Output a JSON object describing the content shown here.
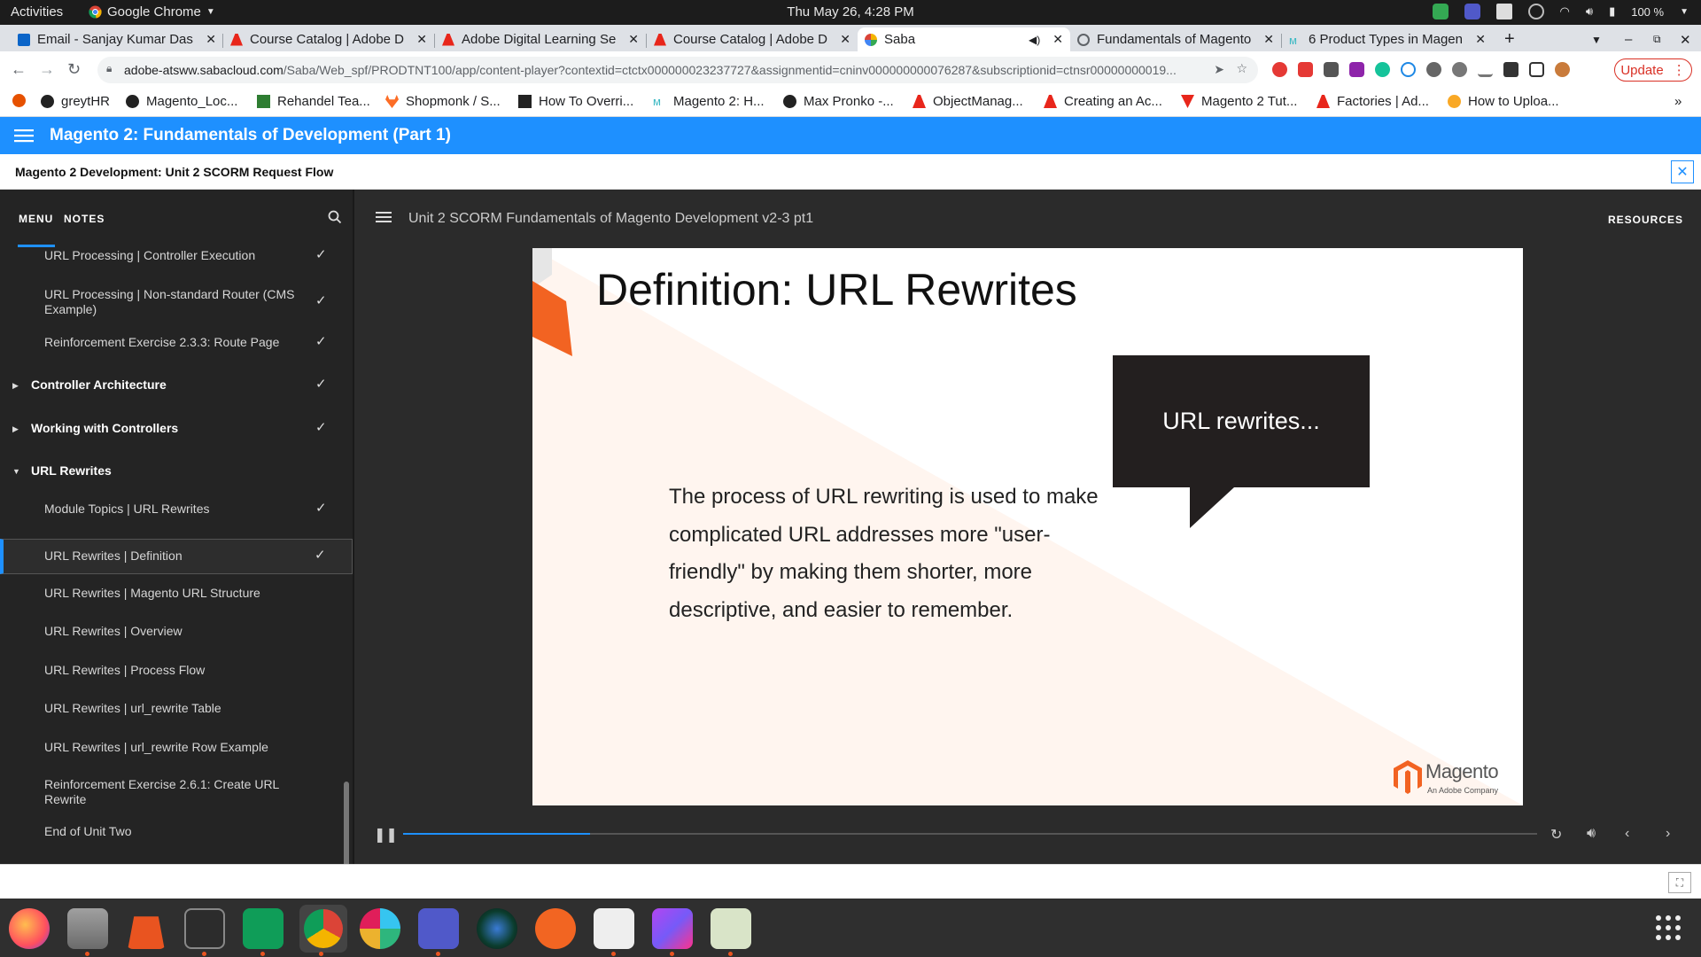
{
  "system": {
    "activities": "Activities",
    "app_name": "Google Chrome",
    "clock": "Thu May 26,  4:28 PM",
    "battery": "100 %"
  },
  "tabs": [
    {
      "title": "Email - Sanjay Kumar Das",
      "favicon": "outlook-icon"
    },
    {
      "title": "Course Catalog | Adobe D",
      "favicon": "adobe-icon"
    },
    {
      "title": "Adobe Digital Learning Se",
      "favicon": "adobe-icon"
    },
    {
      "title": "Course Catalog | Adobe D",
      "favicon": "adobe-icon"
    },
    {
      "title": "Saba",
      "favicon": "saba-icon",
      "active": true
    },
    {
      "title": "Fundamentals of Magento",
      "favicon": "globe-icon"
    },
    {
      "title": "6 Product Types in Magen",
      "favicon": "magento-icon"
    }
  ],
  "address": {
    "host": "adobe-atsww.sabacloud.com",
    "path": "/Saba/Web_spf/PRODTNT100/app/content-player?contextid=ctctx000000023237727&assignmentid=cninv000000000076287&subscriptionid=ctnsr00000000019...",
    "update_label": "Update"
  },
  "bookmarks": [
    "greytHR",
    "Magento_Loc...",
    "Rehandel Tea...",
    "Shopmonk / S...",
    "How To Overri...",
    "Magento 2: H...",
    "Max Pronko -...",
    "ObjectManag...",
    "Creating an Ac...",
    "Magento 2 Tut...",
    "Factories | Ad...",
    "How to Uploa..."
  ],
  "course": {
    "title": "Magento 2: Fundamentals of Development (Part 1)",
    "unit_title": "Magento 2 Development: Unit 2 SCORM Request Flow"
  },
  "sidebar": {
    "menu_tab": "MENU",
    "notes_tab": "NOTES",
    "items": [
      {
        "label": "URL Processing | Controller Execution",
        "checked": true,
        "type": "sub"
      },
      {
        "label": "URL Processing | Non-standard Router (CMS Example)",
        "checked": true,
        "type": "sub"
      },
      {
        "label": "Reinforcement Exercise 2.3.3: Route Page",
        "checked": true,
        "type": "sub"
      },
      {
        "label": "Controller Architecture",
        "checked": true,
        "type": "section",
        "expanded": false
      },
      {
        "label": "Working with Controllers",
        "checked": true,
        "type": "section",
        "expanded": false
      },
      {
        "label": "URL Rewrites",
        "checked": false,
        "type": "section",
        "expanded": true
      },
      {
        "label": "Module Topics | URL Rewrites",
        "checked": true,
        "type": "sub"
      },
      {
        "label": "URL Rewrites | Definition",
        "checked": true,
        "type": "sub",
        "active": true
      },
      {
        "label": "URL Rewrites | Magento URL Structure",
        "checked": false,
        "type": "sub"
      },
      {
        "label": "URL Rewrites | Overview",
        "checked": false,
        "type": "sub"
      },
      {
        "label": "URL Rewrites | Process Flow",
        "checked": false,
        "type": "sub"
      },
      {
        "label": "URL Rewrites | url_rewrite Table",
        "checked": false,
        "type": "sub"
      },
      {
        "label": "URL Rewrites | url_rewrite Row Example",
        "checked": false,
        "type": "sub"
      },
      {
        "label": "Reinforcement Exercise 2.6.1: Create URL Rewrite",
        "checked": false,
        "type": "sub"
      },
      {
        "label": "End of Unit Two",
        "checked": false,
        "type": "sub"
      }
    ]
  },
  "content": {
    "title": "Unit 2 SCORM Fundamentals of Magento Development v2-3 pt1",
    "resources_label": "RESOURCES"
  },
  "slide": {
    "heading": "Definition: URL Rewrites",
    "bubble": "URL rewrites...",
    "body": "The process of URL rewriting is used to make complicated URL addresses more \"user-friendly\" by making them shorter, more descriptive, and easier to remember.",
    "logo_text": "Magento",
    "logo_sub": "An Adobe Company"
  },
  "player": {
    "progress": 0.165
  },
  "colors": {
    "accent": "#1e90ff",
    "magento_orange": "#f26322",
    "sidebar_bg": "#242424",
    "content_bg": "#2b2b2b"
  }
}
